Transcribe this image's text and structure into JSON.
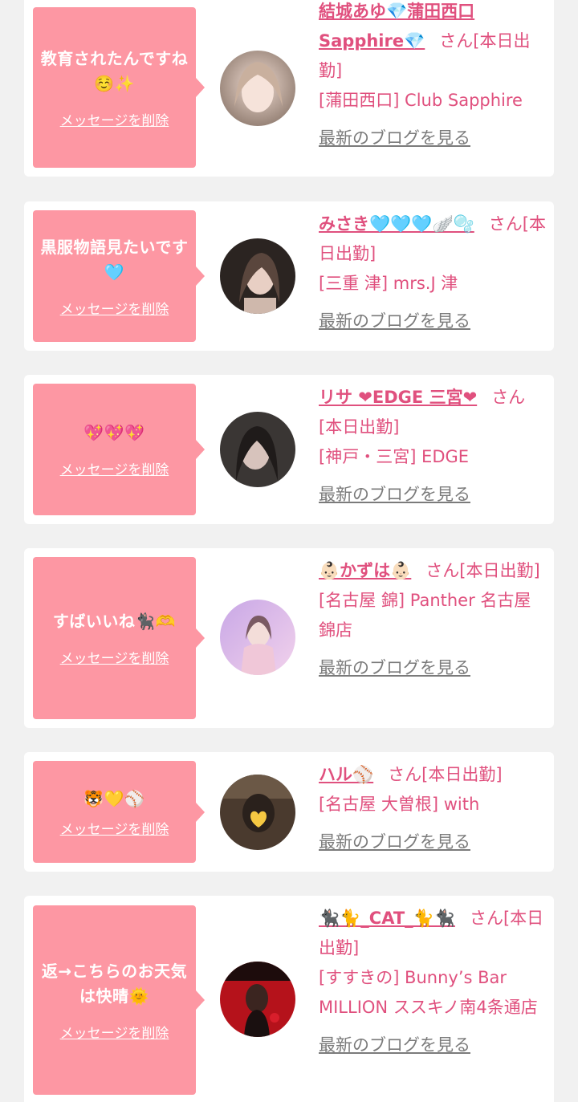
{
  "delete_label": "メッセージを削除",
  "blog_label": "最新のブログを見る",
  "colors": {
    "page_bg": "#f1f1f1",
    "card_bg": "#ffffff",
    "bubble_bg": "#fd97a3",
    "accent_text": "#e0507e",
    "link_gray": "#7b7b7b"
  },
  "entries": [
    {
      "message": "教育されたんですね☺️✨",
      "name": "結城あゆ💎蒲田西口Sapphire💎",
      "suffix": "さん[本日出勤]",
      "shop": "[蒲田西口] Club Sapphire",
      "avatar_icon": "avatar-photo-icon"
    },
    {
      "message": "黒服物語見たいです🩵",
      "name": "みさき🩵🩵🩵🪽🫧",
      "suffix": "さん[本日出勤]",
      "shop": "[三重 津] mrs.J 津",
      "avatar_icon": "avatar-photo-icon"
    },
    {
      "message": "💖💖💖",
      "name": "リサ ❤EDGE 三宮❤",
      "suffix": "さん[本日出勤]",
      "shop": "[神戸・三宮] EDGE",
      "avatar_icon": "avatar-photo-icon"
    },
    {
      "message": "すばいいね🐈‍⬛🫶",
      "name": "👶🏻かずは👶🏻",
      "suffix": "さん[本日出勤]",
      "shop": "[名古屋 錦] Panther 名古屋錦店",
      "avatar_icon": "avatar-photo-icon"
    },
    {
      "message": "🐯💛⚾️",
      "name": "ハル⚾️",
      "suffix": "さん[本日出勤]",
      "shop": "[名古屋 大曽根] with",
      "avatar_icon": "avatar-photo-icon"
    },
    {
      "message": "返→こちらのお天気は快晴🌞",
      "name": "🐈‍⬛🐈_CAT_🐈🐈‍⬛",
      "suffix": "さん[本日出勤]",
      "shop": "[すすきの] Bunny’s Bar MILLION ススキノ南4条通店",
      "avatar_icon": "avatar-photo-icon"
    }
  ]
}
